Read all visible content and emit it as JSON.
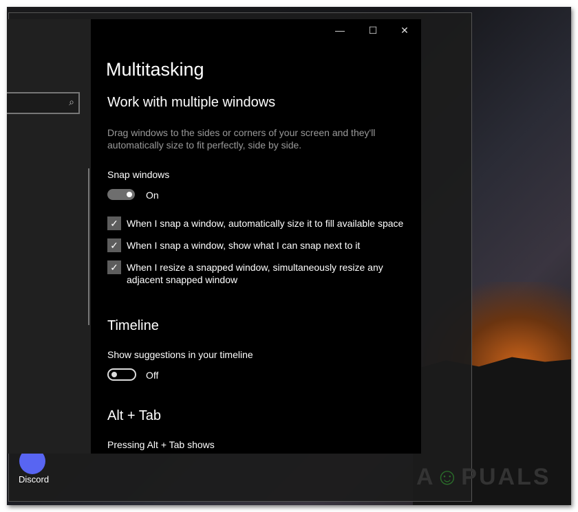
{
  "window": {
    "title": "Multitasking",
    "controls": {
      "minimize": "—",
      "maximize": "☐",
      "close": "✕"
    }
  },
  "search": {
    "icon": "⌕"
  },
  "sections": {
    "snap": {
      "heading": "Work with multiple windows",
      "description_1": "Drag windows to the sides or corners of your screen and they'll",
      "description_2": "automatically size to fit perfectly, side by side.",
      "label": "Snap windows",
      "toggle_state": "On",
      "options": [
        {
          "line1": "When I snap a window, automatically size it to fill available space",
          "checked": true
        },
        {
          "line1": "When I snap a window, show what I can snap next to it",
          "checked": true
        },
        {
          "line1": "When I resize a snapped window, simultaneously resize any",
          "line2": "adjacent snapped window",
          "checked": true
        }
      ]
    },
    "timeline": {
      "heading": "Timeline",
      "label": "Show suggestions in your timeline",
      "toggle_state": "Off"
    },
    "alttab": {
      "heading": "Alt + Tab",
      "label": "Pressing Alt + Tab shows"
    }
  },
  "desktop": {
    "icons": [
      {
        "label": "Discord"
      }
    ],
    "watermark": "APPUALS"
  }
}
